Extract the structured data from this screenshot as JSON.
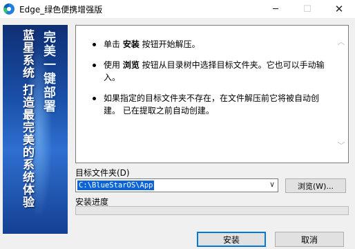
{
  "window": {
    "title": "Edge_绿色便携增强版",
    "minimize_glyph": "─",
    "maximize_glyph": "☐",
    "close_glyph": "✕"
  },
  "banner": {
    "line_main": "完美一键部署",
    "line_sub": "蓝星系统  打造最完美的系统体验"
  },
  "info": {
    "items": [
      {
        "pre": "单击 ",
        "bold": "安装",
        "post": " 按钮开始解压。"
      },
      {
        "pre": "使用 ",
        "bold": "浏览",
        "post": " 按钮从目录树中选择目标文件夹。它也可以手动输入。"
      },
      {
        "pre": "如果指定的目标文件夹不存在，在文件解压前它将被自动创建。 已在提取之前自动创建。",
        "bold": "",
        "post": ""
      }
    ]
  },
  "destination": {
    "label": "目标文件夹(D)",
    "value": "C:\\BlueStarOS\\App",
    "browse_label": "浏览(W)..."
  },
  "progress": {
    "label": "安装进度",
    "fraction": 0
  },
  "buttons": {
    "install": "安装",
    "cancel": "取消"
  },
  "colors": {
    "selection": "#0a64d8",
    "progress_fill": "#06b025"
  }
}
